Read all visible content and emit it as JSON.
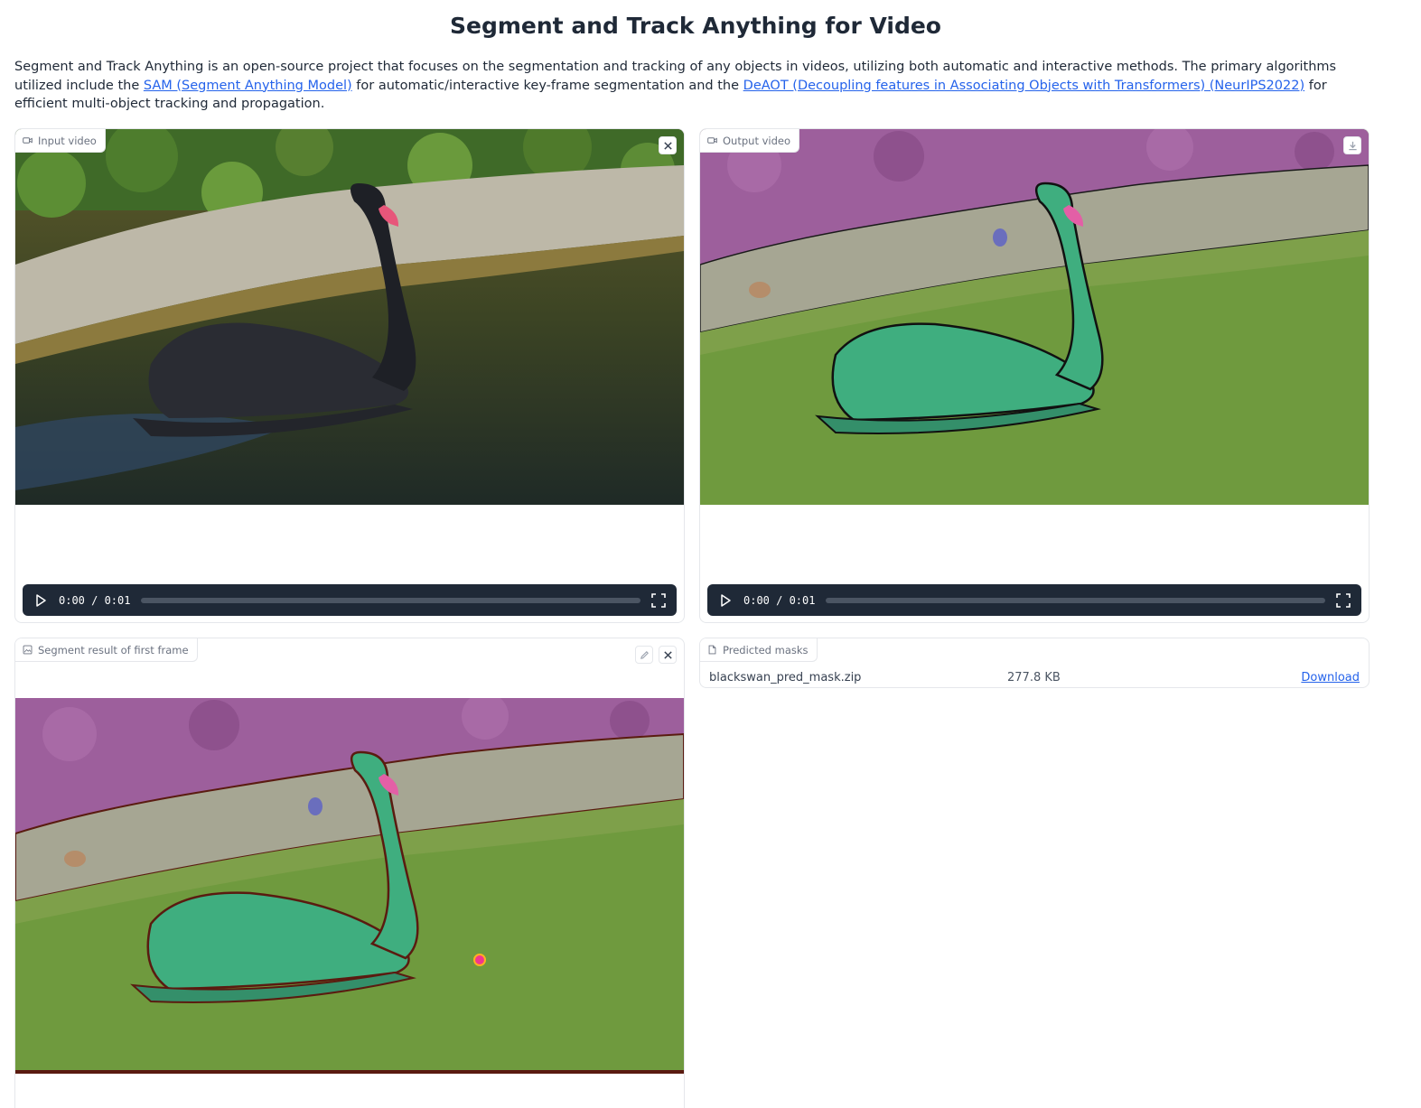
{
  "page": {
    "title": "Segment and Track Anything for Video",
    "intro": {
      "part1": "Segment and Track Anything is an open-source project that focuses on the segmentation and tracking of any objects in videos, utilizing both automatic and interactive methods. The primary algorithms utilized include the ",
      "link1": "SAM (Segment Anything Model)",
      "part2": " for automatic/interactive key-frame segmentation and the ",
      "link2": "DeAOT (Decoupling features in Associating Objects with Transformers) (NeurIPS2022)",
      "part3": " for efficient multi-object tracking and propagation."
    }
  },
  "input_video": {
    "label": "Input video",
    "label_icon": "video-camera-icon",
    "close_icon": "close-icon",
    "time": "0:00 / 0:01",
    "progress": 0
  },
  "output_video": {
    "label": "Output video",
    "label_icon": "video-camera-icon",
    "download_icon": "download-icon",
    "time": "0:00 / 0:01",
    "progress": 0
  },
  "segment_result": {
    "label": "Segment result of first frame",
    "label_icon": "image-icon",
    "edit_icon": "pencil-icon",
    "close_icon": "close-icon"
  },
  "predicted_masks": {
    "label": "Predicted masks",
    "label_icon": "file-icon",
    "file_name": "blackswan_pred_mask.zip",
    "file_size": "277.8 KB",
    "download_label": "Download"
  },
  "colors": {
    "link": "#2563eb",
    "player_bg": "#1f2937",
    "mask_background": "#9d5f9c",
    "mask_water": "#6f9a3e",
    "mask_swan": "#3fae7f"
  }
}
